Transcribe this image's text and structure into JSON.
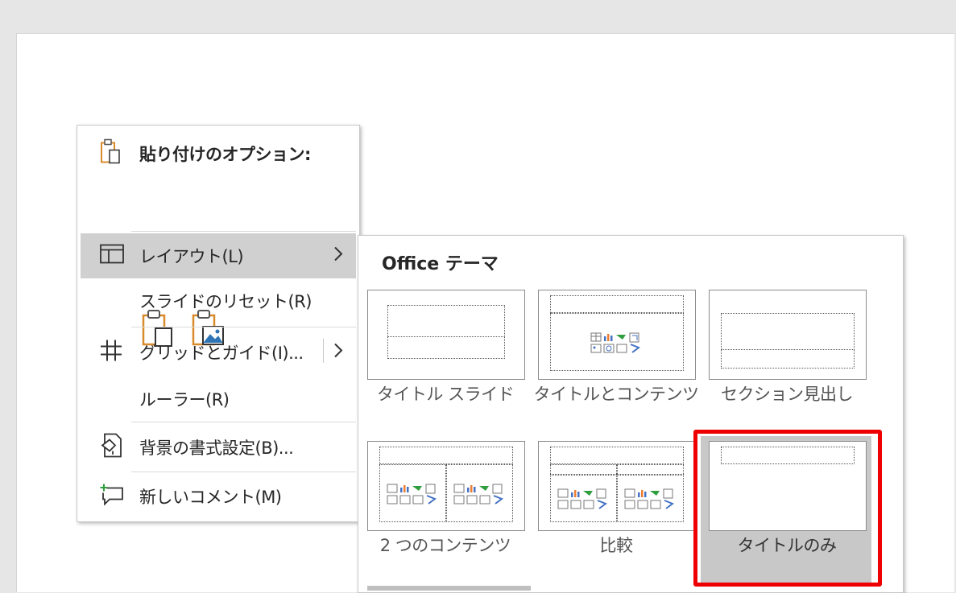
{
  "context_menu": {
    "paste_header": "貼り付けのオプション:",
    "paste_options": [
      {
        "icon": "paste-keep-source-icon"
      },
      {
        "icon": "paste-picture-icon"
      }
    ],
    "items": [
      {
        "label": "レイアウト(L)",
        "icon": "layout-icon",
        "submenu": true
      },
      {
        "label": "スライドのリセット(R)"
      },
      {
        "label": "グリッドとガイド(I)...",
        "icon": "grid-icon",
        "submenu": true
      },
      {
        "label": "ルーラー(R)"
      },
      {
        "label": "背景の書式設定(B)...",
        "icon": "background-format-icon"
      },
      {
        "label": "新しいコメント(M)",
        "icon": "new-comment-icon"
      }
    ]
  },
  "layout_submenu": {
    "title": "Office テーマ",
    "layouts": [
      {
        "label": "タイトル スライド"
      },
      {
        "label": "タイトルとコンテンツ"
      },
      {
        "label": "セクション見出し"
      },
      {
        "label": "2 つのコンテンツ"
      },
      {
        "label": "比較"
      },
      {
        "label": "タイトルのみ",
        "selected": true
      }
    ]
  },
  "colors": {
    "highlight": "#ee0000",
    "hover": "#d0d0d0",
    "icon_orange": "#d98b2b"
  }
}
